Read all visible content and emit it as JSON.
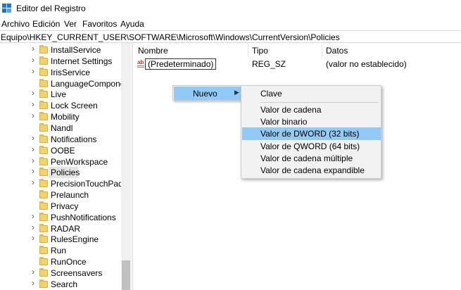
{
  "window": {
    "title": "Editor del Registro"
  },
  "menubar": {
    "items": [
      "Archivo",
      "Edición",
      "Ver",
      "Favoritos",
      "Ayuda"
    ]
  },
  "address": {
    "path": "Equipo\\HKEY_CURRENT_USER\\SOFTWARE\\Microsoft\\Windows\\CurrentVersion\\Policies"
  },
  "tree": {
    "items": [
      {
        "label": "InstallService",
        "expandable": true
      },
      {
        "label": "Internet Settings",
        "expandable": true
      },
      {
        "label": "IrisService",
        "expandable": true
      },
      {
        "label": "LanguageComponent",
        "expandable": false
      },
      {
        "label": "Live",
        "expandable": true
      },
      {
        "label": "Lock Screen",
        "expandable": true
      },
      {
        "label": "Mobility",
        "expandable": true
      },
      {
        "label": "Nandl",
        "expandable": false
      },
      {
        "label": "Notifications",
        "expandable": true
      },
      {
        "label": "OOBE",
        "expandable": true
      },
      {
        "label": "PenWorkspace",
        "expandable": true
      },
      {
        "label": "Policies",
        "expandable": true,
        "selected": true
      },
      {
        "label": "PrecisionTouchPad",
        "expandable": true
      },
      {
        "label": "Prelaunch",
        "expandable": false
      },
      {
        "label": "Privacy",
        "expandable": false
      },
      {
        "label": "PushNotifications",
        "expandable": true
      },
      {
        "label": "RADAR",
        "expandable": true
      },
      {
        "label": "RulesEngine",
        "expandable": true
      },
      {
        "label": "Run",
        "expandable": false
      },
      {
        "label": "RunOnce",
        "expandable": false
      },
      {
        "label": "Screensavers",
        "expandable": true
      },
      {
        "label": "Search",
        "expandable": true
      }
    ]
  },
  "list": {
    "columns": [
      "Nombre",
      "Tipo",
      "Datos"
    ],
    "rows": [
      {
        "name": "(Predeterminado)",
        "type": "REG_SZ",
        "data": "(valor no establecido)",
        "icon": "string-value-icon"
      }
    ]
  },
  "context_menu": {
    "item": "Nuevo"
  },
  "submenu": {
    "items": [
      "Clave",
      "Valor de cadena",
      "Valor binario",
      "Valor de DWORD (32 bits)",
      "Valor de QWORD (64 bits)",
      "Valor de cadena múltiple",
      "Valor de cadena expandible"
    ],
    "highlighted_index": 3
  },
  "colors": {
    "highlight": "#91c9f7",
    "folder": "#f3d26a",
    "selected_tree": "#e5e5e5"
  }
}
